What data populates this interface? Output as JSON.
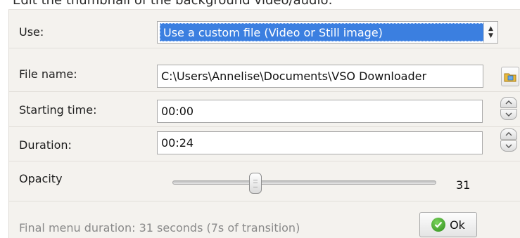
{
  "header": {
    "text": "Edit the thumbnail of the background video/audio:"
  },
  "use": {
    "label": "Use:",
    "value": "Use a custom file (Video or Still image)",
    "arrows_icon": "updown-arrows-icon"
  },
  "file": {
    "label": "File name:",
    "value": "C:\\Users\\Annelise\\Documents\\VSO Downloader",
    "browse_icon": "folder-icon"
  },
  "start": {
    "label": "Starting time:",
    "value": "00:00"
  },
  "duration": {
    "label": "Duration:",
    "value": "00:24"
  },
  "opacity": {
    "label": "Opacity",
    "value": "31",
    "level_percent": 31
  },
  "footer": {
    "text": "Final menu duration: 31 seconds  (7s  of transition)",
    "ok_label": "Ok",
    "ok_icon": "checkmark-icon"
  },
  "colors": {
    "selection": "#3b7fe0",
    "panel_bg": "#f4f2ee",
    "ok_green": "#3a9a22"
  }
}
